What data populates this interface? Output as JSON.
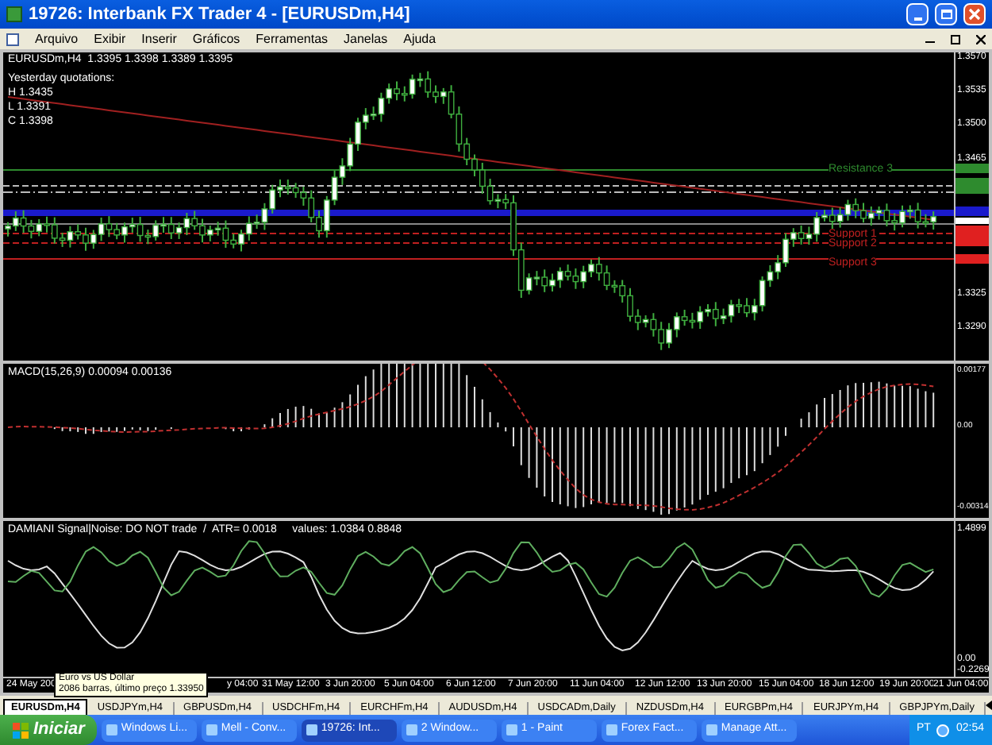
{
  "window": {
    "title": "19726: Interbank FX Trader 4 - [EURUSDm,H4]"
  },
  "menu": [
    "Arquivo",
    "Exibir",
    "Inserir",
    "Gráficos",
    "Ferramentas",
    "Janelas",
    "Ajuda"
  ],
  "main_chart": {
    "header": "EURUSDm,H4  1.3395 1.3398 1.3389 1.3395",
    "yesterday_title": "Yesterday quotations:",
    "yesterday_lines": [
      "H 1.3435",
      "L 1.3391",
      "C 1.3398"
    ],
    "level_labels": [
      {
        "label": "Resistance 3",
        "color": "#2e8b2e"
      },
      {
        "label": "Support 1",
        "color": "#c02020"
      },
      {
        "label": "Support 2",
        "color": "#c02020"
      },
      {
        "label": "Support 3",
        "color": "#c02020"
      }
    ],
    "price_axis": [
      "1.3570",
      "1.3535",
      "1.3500",
      "1.3465",
      "1.3325",
      "1.3290"
    ]
  },
  "macd": {
    "title": "MACD(15,26,9) 0.00094 0.00136",
    "axis": [
      "0.00177",
      "0.00",
      "-0.00314"
    ]
  },
  "damiani": {
    "title": "DAMIANI Signal|Noise: DO NOT trade  /  ATR= 0.0018     values: 1.0384 0.8848",
    "axis": [
      "1.4899",
      "0.00",
      "-0.2269"
    ]
  },
  "time_axis": [
    "24 May 200",
    "y 04:00",
    "31 May 12:00",
    "3 Jun 20:00",
    "5 Jun 04:00",
    "6 Jun 12:00",
    "7 Jun 20:00",
    "11 Jun 04:00",
    "12 Jun 12:00",
    "13 Jun 20:00",
    "15 Jun 04:00",
    "18 Jun 12:00",
    "19 Jun 20:00",
    "21 Jun 04:00"
  ],
  "tooltip": [
    "Euro vs US Dollar",
    "2086 barras, último preço 1.33950"
  ],
  "symbol_tabs": [
    {
      "label": "EURUSDm,H4",
      "selected": true
    },
    {
      "label": "USDJPYm,H4",
      "selected": false
    },
    {
      "label": "GBPUSDm,H4",
      "selected": false
    },
    {
      "label": "USDCHFm,H4",
      "selected": false
    },
    {
      "label": "EURCHFm,H4",
      "selected": false
    },
    {
      "label": "AUDUSDm,H4",
      "selected": false
    },
    {
      "label": "USDCADm,Daily",
      "selected": false
    },
    {
      "label": "NZDUSDm,H4",
      "selected": false
    },
    {
      "label": "EURGBPm,H4",
      "selected": false
    },
    {
      "label": "EURJPYm,H4",
      "selected": false
    },
    {
      "label": "GBPJPYm,Daily",
      "selected": false
    }
  ],
  "taskbar": {
    "start": "Iniciar",
    "tasks": [
      {
        "label": "Windows Li...",
        "selected": false
      },
      {
        "label": "Mell - Conv...",
        "selected": false
      },
      {
        "label": "19726: Int...",
        "selected": true
      },
      {
        "label": "2 Window...",
        "selected": false
      },
      {
        "label": "1 - Paint",
        "selected": false
      },
      {
        "label": "Forex Fact...",
        "selected": false
      },
      {
        "label": "Manage Att...",
        "selected": false
      }
    ],
    "language": "PT",
    "clock": "02:54"
  }
}
